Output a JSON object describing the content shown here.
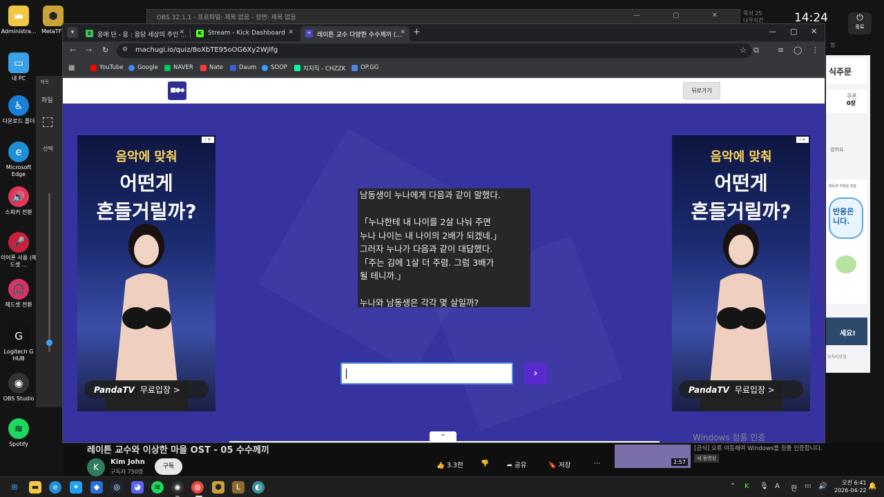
{
  "desktop": {
    "icons": [
      {
        "label": "Administra...",
        "icon": "folder-icon"
      },
      {
        "label": "MetaTFT",
        "icon": "metatft-icon"
      },
      {
        "label": "내 PC",
        "icon": "monitor-icon"
      },
      {
        "label": "다운로드 폴더",
        "icon": "accessibility-icon"
      },
      {
        "label": "Microsoft Edge",
        "icon": "edge-icon"
      },
      {
        "label": "스피커 전환",
        "icon": "speaker-icon"
      },
      {
        "label": "이어폰 사용 (헤드셋 ...",
        "icon": "microphone-icon"
      },
      {
        "label": "헤드셋 전환",
        "icon": "headset-icon"
      },
      {
        "label": "Logitech G HUB",
        "icon": "logitech-icon"
      },
      {
        "label": "OBS Studio",
        "icon": "obs-icon"
      },
      {
        "label": "Spotify",
        "icon": "spotify-icon"
      }
    ]
  },
  "obs": {
    "title": "OBS 32.1.1 - 프로파일: 제목 없음 - 장면: 제목 없음",
    "left_panel": {
      "menu": "파일",
      "tool": "선택",
      "title": "제목"
    }
  },
  "system": {
    "clock": "14:24",
    "weather": "목식 25\n나우시간",
    "power_label": "종료"
  },
  "side_app": {
    "order_label": "식주문",
    "coupon_label": "쿠폰",
    "coupon_count": "0장",
    "small_note": "었어요.",
    "promo_text": "반응은 니다.",
    "promo_top": "돼동쟁 여행을 포함",
    "dark_text": "세요!",
    "footer": "보처리방침",
    "extra": "정"
  },
  "browser": {
    "tabs": [
      {
        "title": "응애 단 - 응 : 응당 세상의 주인 ...",
        "favicon_color": "#3fbf5a",
        "active": false
      },
      {
        "title": "Stream - Kick Dashboard",
        "favicon_color": "#53fc18",
        "active": false
      },
      {
        "title": "레이튼 교수 다양한 수수께끼 (...",
        "favicon_color": "#4b47c9",
        "active": true
      }
    ],
    "url": "machugi.io/quiz/8oXbTE95oOG6Xy2WjIfg",
    "bookmarks": [
      {
        "label": "YouTube",
        "color": "#ff0000"
      },
      {
        "label": "Google",
        "color": "#4285f4"
      },
      {
        "label": "NAVER",
        "color": "#03c75a"
      },
      {
        "label": "Nate",
        "color": "#ff3b3b"
      },
      {
        "label": "Daum",
        "color": "#3c5bd6"
      },
      {
        "label": "SOOP",
        "color": "#3aa0ff"
      },
      {
        "label": "치지직 - CHZZK",
        "color": "#00ffa3"
      },
      {
        "label": "OP.GG",
        "color": "#5383e8"
      }
    ]
  },
  "page": {
    "logo_text": "■●◆",
    "back_button": "뒤로가기",
    "question": "남동생이 누나에게 다음과 같이 말했다.\n\n「누나한테 내 나이를 2살 나눠 주면\n누나 나이는 내 나이의 2배가 되겠네.」\n그러자 누나가 다음과 같이 대답했다.\n「주는 김에 1살 더 주렴. 그럼 3배가\n될 테니까.」\n\n누나와 남동생은 각각 몇 살일까?",
    "answer_value": "",
    "submit_icon": "chevron-right-icon",
    "scroll_icon": "chevron-up-icon",
    "ad": {
      "adchoice": "i ✕",
      "line1": "음악에 맞춰",
      "line2": "어떤게",
      "line3": "흔들거릴까?",
      "brand": "PandaTV",
      "cta": "무료입장 >"
    }
  },
  "youtube": {
    "video_title": "레이튼 교수와 이상한 마을 OST - 05 수수께끼",
    "avatar_letter": "K",
    "channel": "Kim John",
    "subscribers": "구독자 750명",
    "subscribe": "구독",
    "like_count": "3.3천",
    "share": "공유",
    "save": "저장",
    "side_duration": "2:57",
    "side_text": "[공식] 오류 이동해여 Windows를 정품 인증합니다.",
    "side_badge": "새 동영상"
  },
  "activation_text": "Windows 정품 인증",
  "taskbar": {
    "apps": [
      "start-icon",
      "file-explorer-icon",
      "edge-icon",
      "bird-icon",
      "blue-app-icon",
      "steam-icon",
      "discord-icon",
      "spotify-icon",
      "obs-icon",
      "chrome-icon",
      "metatft-icon",
      "lol-icon",
      "globe-icon"
    ],
    "tray_lang": "한",
    "tray_letter": "A",
    "time": "오전 6:41",
    "date": "2026-04-22"
  }
}
